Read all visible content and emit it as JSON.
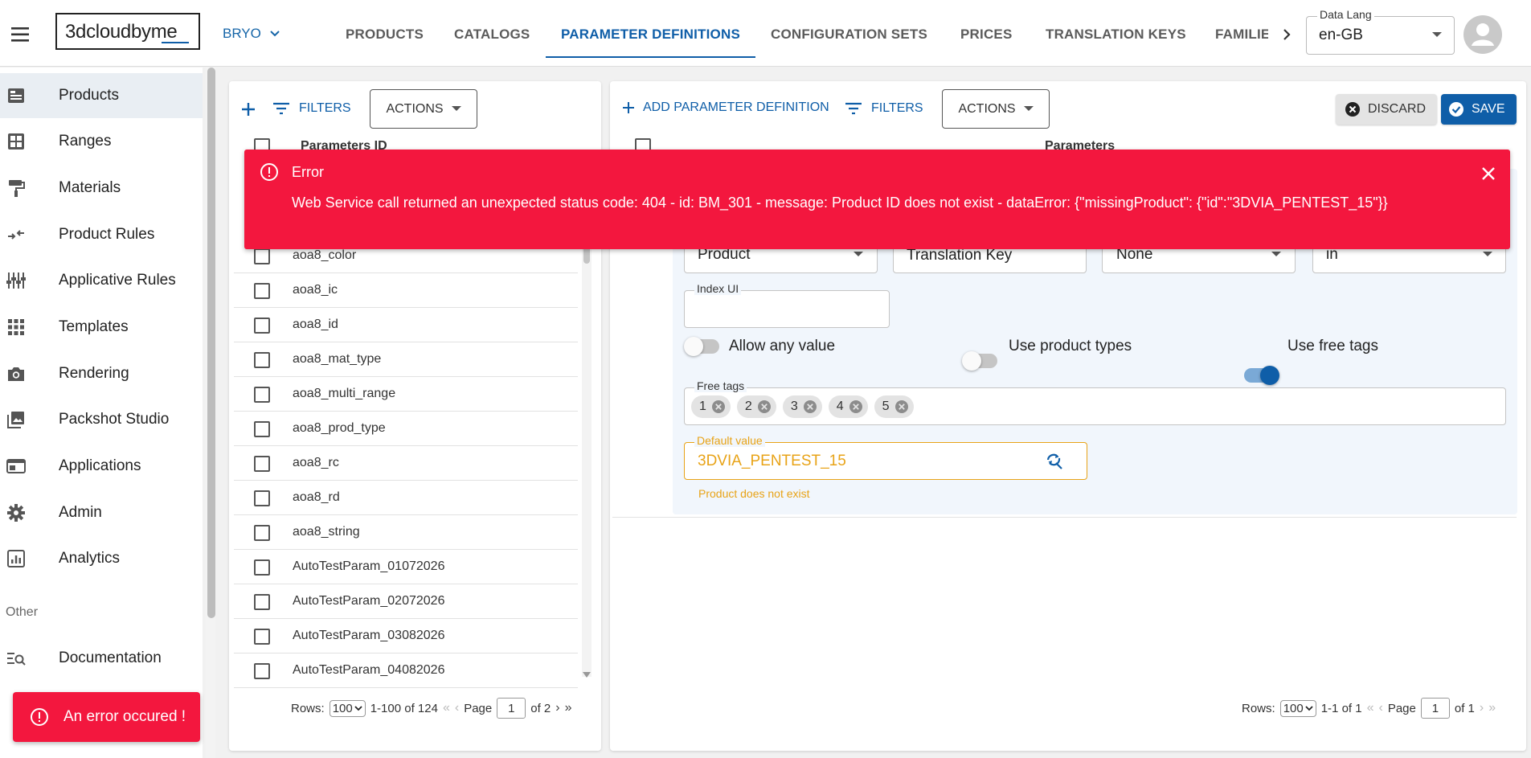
{
  "header": {
    "logo_text": "3dcloudbyme",
    "brand": "BRYO",
    "tabs": [
      {
        "label": "PRODUCTS"
      },
      {
        "label": "CATALOGS"
      },
      {
        "label": "PARAMETER DEFINITIONS"
      },
      {
        "label": "CONFIGURATION SETS"
      },
      {
        "label": "PRICES"
      },
      {
        "label": "TRANSLATION KEYS"
      },
      {
        "label": "FAMILIE"
      }
    ],
    "active_tab": "PARAMETER DEFINITIONS",
    "data_lang": {
      "label": "Data Lang",
      "value": "en-GB"
    }
  },
  "sidebar": {
    "items": [
      {
        "label": "Products",
        "icon": "products-icon"
      },
      {
        "label": "Ranges",
        "icon": "ranges-icon"
      },
      {
        "label": "Materials",
        "icon": "paint-roller-icon"
      },
      {
        "label": "Product Rules",
        "icon": "rules-arrows-icon"
      },
      {
        "label": "Applicative Rules",
        "icon": "sliders-icon"
      },
      {
        "label": "Templates",
        "icon": "grid-icon"
      },
      {
        "label": "Rendering",
        "icon": "camera-icon"
      },
      {
        "label": "Packshot Studio",
        "icon": "image-stack-icon"
      },
      {
        "label": "Applications",
        "icon": "window-icon"
      },
      {
        "label": "Admin",
        "icon": "gear-icon"
      },
      {
        "label": "Analytics",
        "icon": "analytics-icon"
      }
    ],
    "section_other": "Other",
    "other_items": [
      {
        "label": "Documentation",
        "icon": "doc-search-icon"
      }
    ]
  },
  "left_panel": {
    "toolbar": {
      "filters": "FILTERS",
      "actions": "ACTIONS"
    },
    "column_header": "Parameters ID",
    "rows": [
      "aoa8_color",
      "aoa8_ic",
      "aoa8_id",
      "aoa8_mat_type",
      "aoa8_multi_range",
      "aoa8_prod_type",
      "aoa8_rc",
      "aoa8_rd",
      "aoa8_string",
      "AutoTestParam_01072026",
      "AutoTestParam_02072026",
      "AutoTestParam_03082026",
      "AutoTestParam_04082026"
    ],
    "footer": {
      "rows_label": "Rows:",
      "rows_value": "100",
      "range": "1-100 of 124",
      "page_label": "Page",
      "page_value": "1",
      "of_pages": "of 2"
    }
  },
  "right_panel": {
    "toolbar": {
      "add": "ADD PARAMETER DEFINITION",
      "filters": "FILTERS",
      "actions": "ACTIONS",
      "discard": "DISCARD",
      "save": "SAVE"
    },
    "column_header": "Parameters",
    "editor": {
      "selects": [
        "Product",
        "Translation Key",
        "None",
        "in"
      ],
      "index_ui": {
        "label": "Index UI",
        "value": ""
      },
      "toggles": [
        {
          "label": "Allow any value",
          "on": false
        },
        {
          "label": "Use product types",
          "on": false
        },
        {
          "label": "Use free tags",
          "on": true
        }
      ],
      "free_tags": {
        "label": "Free tags",
        "tags": [
          "1",
          "2",
          "3",
          "4",
          "5"
        ]
      },
      "default_value": {
        "label": "Default value",
        "value": "3DVIA_PENTEST_15",
        "helper": "Product does not exist"
      }
    },
    "footer": {
      "rows_label": "Rows:",
      "rows_value": "100",
      "range": "1-1 of 1",
      "page_label": "Page",
      "page_value": "1",
      "of_pages": "of 1"
    }
  },
  "error_banner": {
    "title": "Error",
    "message": "Web Service call returned an unexpected status code: 404 - id: BM_301 - message: Product ID does not exist - dataError: {\"missingProduct\": {\"id\":\"3DVIA_PENTEST_15\"}}"
  },
  "toast": {
    "message": "An error occured !"
  },
  "colors": {
    "primary": "#0f5ea8",
    "error": "#f3173e",
    "warning": "#e8a317"
  }
}
